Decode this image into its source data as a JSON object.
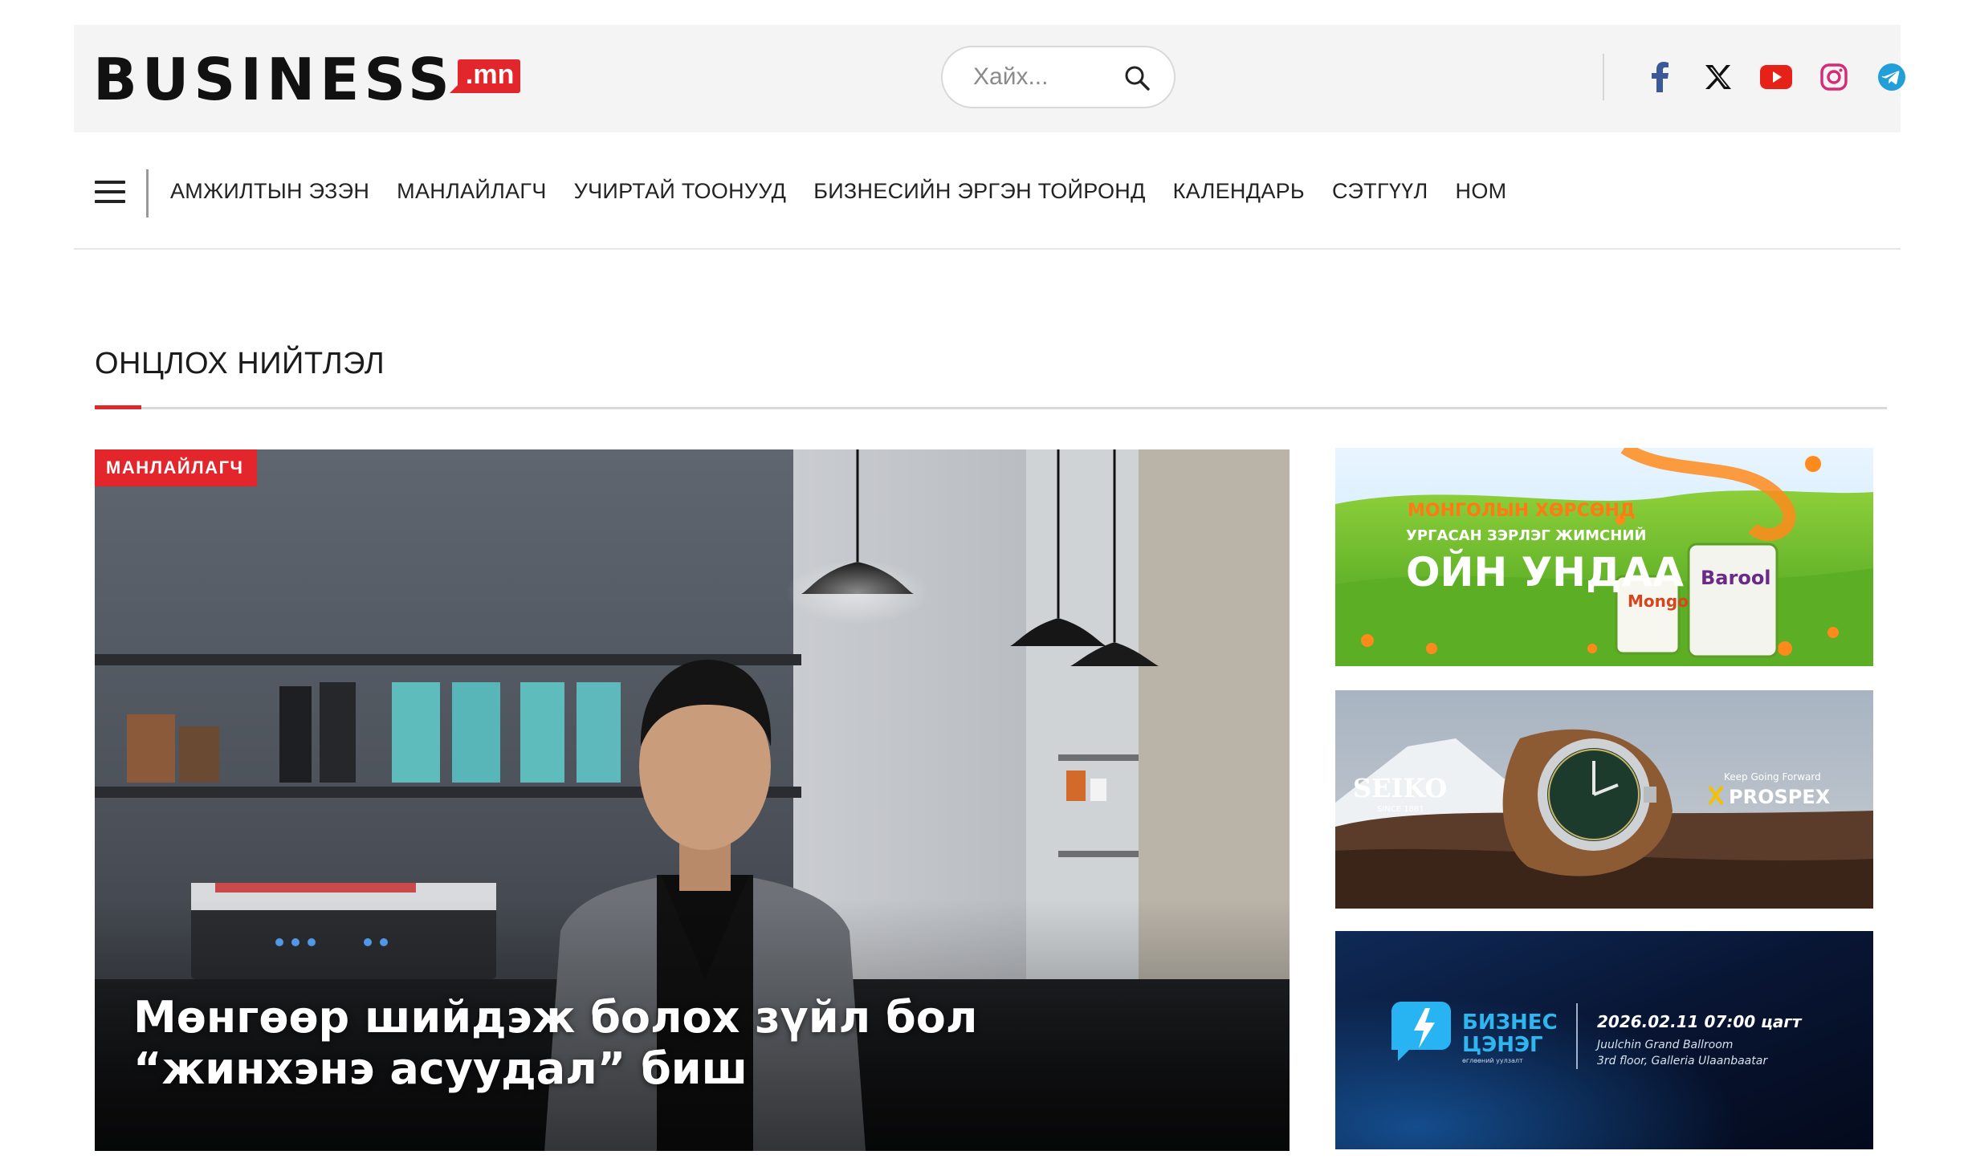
{
  "header": {
    "logo_text": "BUSINESS",
    "logo_badge": "mn",
    "search_placeholder": "Хайх...",
    "socials": [
      "facebook-icon",
      "x-icon",
      "youtube-icon",
      "instagram-icon",
      "telegram-icon"
    ]
  },
  "nav": {
    "items": [
      "АМЖИЛТЫН ЭЗЭН",
      "МАНЛАЙЛАГЧ",
      "УЧИРТАЙ ТООНУУД",
      "БИЗНЕСИЙН ЭРГЭН ТОЙРОНД",
      "КАЛЕНДАРЬ",
      "СЭТГҮҮЛ",
      "НОМ"
    ]
  },
  "section": {
    "title": "ОНЦЛОХ НИЙТЛЭЛ"
  },
  "feature": {
    "tag": "МАНЛАЙЛАГЧ",
    "title": "Мөнгөөр шийдэж болох зүйл бол “жинхэнэ асуудал” биш"
  },
  "ads": {
    "ad1": {
      "line1": "МОНГОЛЫН ХӨРСӨНД",
      "line2": "УРГАСАН ЗЭРЛЭГ ЖИМСНИЙ",
      "line3": "ОЙН УНДАА",
      "pack1": "Mongo",
      "pack2": "Barool"
    },
    "ad2": {
      "brand": "SEIKO",
      "since": "SINCE 1881",
      "tagline": "Keep Going Forward",
      "line": "PROSPEX"
    },
    "ad3": {
      "title1": "БИЗНЕС",
      "title2": "ЦЭНЭГ",
      "sub": "өглөөний уулзалт",
      "date": "2026.02.11 07:00 цагт",
      "venue1": "Juulchin Grand Ballroom",
      "venue2": "3rd floor, Galleria Ulaanbaatar"
    }
  },
  "colors": {
    "brand_red": "#e3262b",
    "header_bg": "#f4f4f4"
  }
}
